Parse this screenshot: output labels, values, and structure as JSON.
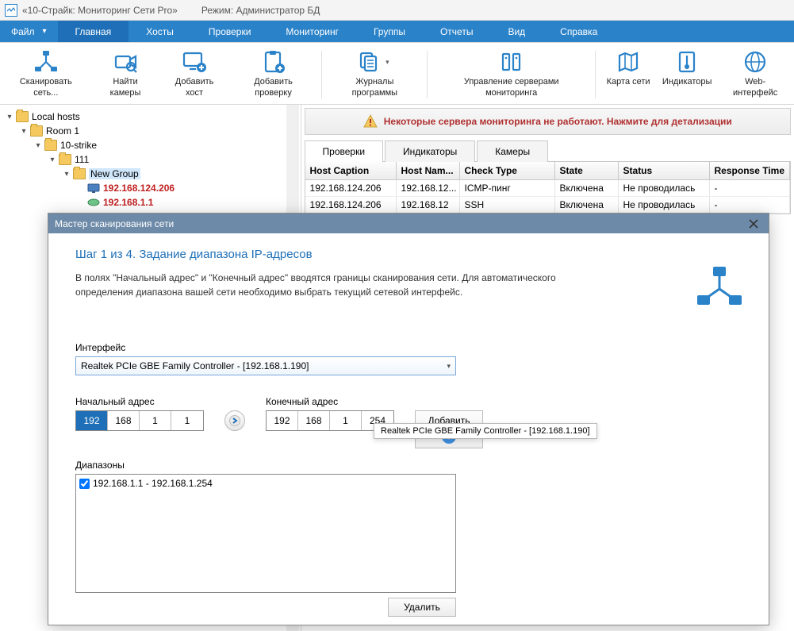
{
  "titlebar": {
    "app_title": "«10-Страйк: Мониторинг Сети Pro»",
    "mode_label": "Режим: Администратор БД"
  },
  "menu": {
    "file": "Файл",
    "tabs": [
      "Главная",
      "Хосты",
      "Проверки",
      "Мониторинг",
      "Группы",
      "Отчеты",
      "Вид",
      "Справка"
    ],
    "active_index": 0
  },
  "ribbon": {
    "scan": "Сканировать сеть...",
    "find_cameras": "Найти камеры",
    "add_host": "Добавить хост",
    "add_check": "Добавить проверку",
    "program_logs": "Журналы программы",
    "server_mgmt": "Управление серверами мониторинга",
    "net_map": "Карта сети",
    "indicators": "Индикаторы",
    "web_iface": "Web-интерфейс"
  },
  "tree": {
    "root": "Local hosts",
    "room": "Room 1",
    "strike": "10-strike",
    "n111": "111",
    "newgroup": "New Group",
    "ip1": "192.168.124.206",
    "ip2": "192.168.1.1"
  },
  "warn": {
    "text": "Некоторые сервера мониторинга не работают. Нажмите для детализации"
  },
  "tabs2": {
    "items": [
      "Проверки",
      "Индикаторы",
      "Камеры"
    ],
    "active_index": 0
  },
  "grid": {
    "headers": [
      "Host Caption",
      "Host Nam...",
      "Check Type",
      "State",
      "Status",
      "Response Time"
    ],
    "rows": [
      [
        "192.168.124.206",
        "192.168.12...",
        "ICMP-пинг",
        "Включена",
        "Не проводилась",
        "-"
      ],
      [
        "192.168.124.206",
        "192.168.12",
        "SSH",
        "Включена",
        "Не проводилась",
        "-"
      ]
    ]
  },
  "wizard": {
    "title": "Мастер сканирования сети",
    "step_title": "Шаг 1 из 4. Задание диапазона IP-адресов",
    "step_desc": "В полях \"Начальный адрес\" и \"Конечный адрес\" вводятся границы сканирования сети. Для автоматического определения диапазона вашей сети необходимо выбрать текущий сетевой интерфейс.",
    "iface_label": "Интерфейс",
    "iface_value": "Realtek PCIe GBE Family Controller - [192.168.1.190]",
    "tooltip": "Realtek PCIe GBE Family Controller - [192.168.1.190]",
    "start_label": "Начальный адрес",
    "end_label": "Конечный адрес",
    "start_octets": [
      "192",
      "168",
      "1",
      "1"
    ],
    "end_octets": [
      "192",
      "168",
      "1",
      "254"
    ],
    "add_btn": "Добавить",
    "ranges_label": "Диапазоны",
    "range_item": "192.168.1.1 - 192.168.1.254",
    "delete_btn": "Удалить"
  },
  "colors": {
    "accent": "#2a82c9",
    "accent_dark": "#1e6fb7",
    "warn": "#b03030"
  }
}
